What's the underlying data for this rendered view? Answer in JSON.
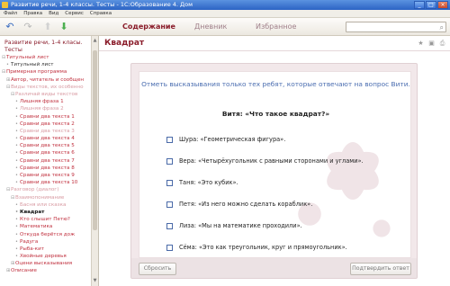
{
  "window": {
    "title": "Развитие речи, 1-4 классы. Тесты - 1С:Образование 4. Дом"
  },
  "menu": [
    "Файл",
    "Правка",
    "Вид",
    "Сервис",
    "Справка"
  ],
  "toolbar": {
    "tabs": [
      {
        "label": "Содержание",
        "active": true
      },
      {
        "label": "Дневник",
        "active": false
      },
      {
        "label": "Избранное",
        "active": false
      }
    ],
    "search_placeholder": ""
  },
  "sidebar": {
    "title": "Развитие речи, 1-4 класы. Тесты",
    "items": [
      {
        "label": "Титульный лист",
        "style": "red",
        "indent": 0,
        "exp": "⊟"
      },
      {
        "label": "Титульный лист",
        "style": "dark",
        "indent": 1,
        "exp": "•"
      },
      {
        "label": "Примерная программа",
        "style": "red",
        "indent": 0,
        "exp": "⊟"
      },
      {
        "label": "Автор, читатель и сообщен",
        "style": "red",
        "indent": 1,
        "exp": "⊞"
      },
      {
        "label": "Виды текстов, их особенно",
        "style": "pink",
        "indent": 1,
        "exp": "⊟"
      },
      {
        "label": "Различай виды текстов",
        "style": "pink",
        "indent": 2,
        "exp": "⊟"
      },
      {
        "label": "Лишняя фраза 1",
        "style": "red",
        "indent": 3,
        "exp": "•"
      },
      {
        "label": "Лишняя фраза 2",
        "style": "pink",
        "indent": 3,
        "exp": "•"
      },
      {
        "label": "Сравни два текста 1",
        "style": "red",
        "indent": 3,
        "exp": "•"
      },
      {
        "label": "Сравни два текста 2",
        "style": "red",
        "indent": 3,
        "exp": "•"
      },
      {
        "label": "Сравни два текста 3",
        "style": "pink",
        "indent": 3,
        "exp": "•"
      },
      {
        "label": "Сравни два текста 4",
        "style": "red",
        "indent": 3,
        "exp": "•"
      },
      {
        "label": "Сравни два текста 5",
        "style": "red",
        "indent": 3,
        "exp": "•"
      },
      {
        "label": "Сравни два текста 6",
        "style": "red",
        "indent": 3,
        "exp": "•"
      },
      {
        "label": "Сравни два текста 7",
        "style": "red",
        "indent": 3,
        "exp": "•"
      },
      {
        "label": "Сравни два текста 8",
        "style": "red",
        "indent": 3,
        "exp": "•"
      },
      {
        "label": "Сравни два текста 9",
        "style": "red",
        "indent": 3,
        "exp": "•"
      },
      {
        "label": "Сравни два текста 10",
        "style": "red",
        "indent": 3,
        "exp": "•"
      },
      {
        "label": "Разговор (диалог)",
        "style": "pink",
        "indent": 1,
        "exp": "⊟"
      },
      {
        "label": "Взаимопонимание",
        "style": "pink",
        "indent": 2,
        "exp": "⊟"
      },
      {
        "label": "Басня или сказка",
        "style": "pink",
        "indent": 3,
        "exp": "•"
      },
      {
        "label": "Квадрат",
        "style": "sel",
        "indent": 3,
        "exp": "•"
      },
      {
        "label": "Кто слышит Петю?",
        "style": "red",
        "indent": 3,
        "exp": "•"
      },
      {
        "label": "Математика",
        "style": "red",
        "indent": 3,
        "exp": "•"
      },
      {
        "label": "Откуда берётся дож",
        "style": "red",
        "indent": 3,
        "exp": "•"
      },
      {
        "label": "Радуга",
        "style": "red",
        "indent": 3,
        "exp": "•"
      },
      {
        "label": "Рыба-кит",
        "style": "red",
        "indent": 3,
        "exp": "•"
      },
      {
        "label": "Хвойные деревья",
        "style": "red",
        "indent": 3,
        "exp": "•"
      },
      {
        "label": "Оцени высказывания",
        "style": "red",
        "indent": 2,
        "exp": "⊞"
      },
      {
        "label": "Описание",
        "style": "red",
        "indent": 1,
        "exp": "⊞"
      }
    ]
  },
  "page": {
    "title": "Квадрат"
  },
  "task": {
    "instruction": "Отметь высказывания только тех ребят, которые отвечают на вопрос Вити.",
    "question": "Витя: «Что такое квадрат?»",
    "options": [
      "Шура: «Геометрическая фигура».",
      "Вера: «Четырёхугольник с равными сторонами и углами».",
      "Таня: «Это кубик».",
      "Петя: «Из него можно сделать кораблик».",
      "Лиза: «Мы на математике проходили».",
      "Сёма: «Это как треугольник, круг и прямоугольник»."
    ],
    "reset_label": "Сбросить",
    "confirm_label": "Подтвердить ответ"
  }
}
